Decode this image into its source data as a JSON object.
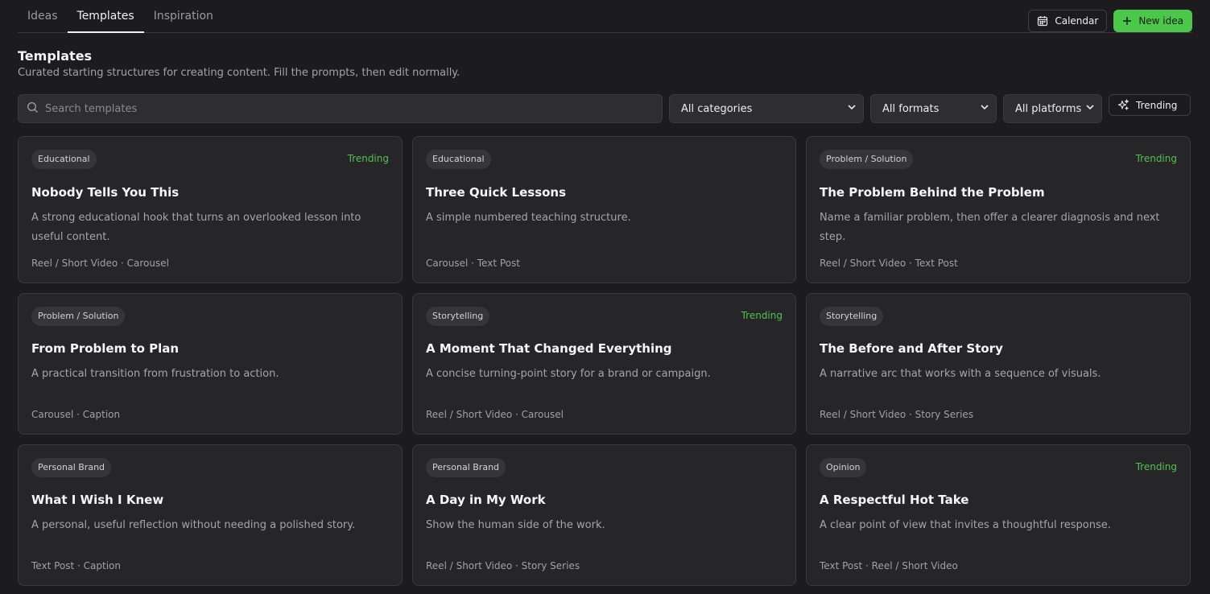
{
  "nav": {
    "tabs": [
      "Ideas",
      "Templates",
      "Inspiration"
    ],
    "active_tab": "Templates"
  },
  "actions": {
    "calendar_label": "Calendar",
    "new_idea_label": "New idea"
  },
  "header": {
    "title": "Templates",
    "subtitle": "Curated starting structures for creating content. Fill the prompts, then edit normally."
  },
  "filters": {
    "search_placeholder": "Search templates",
    "search_value": "",
    "category": "All categories",
    "format": "All formats",
    "platform": "All platforms",
    "trending_label": "Trending"
  },
  "colors": {
    "accent_green": "#4bc84a",
    "trending_text": "#4fc24e",
    "background": "#1c1c1e",
    "card": "#262628"
  },
  "cards": [
    {
      "category": "Educational",
      "trending": "Trending",
      "title": "Nobody Tells You This",
      "description": "A strong educational hook that turns an overlooked lesson into useful content.",
      "formats": "Reel / Short Video · Carousel"
    },
    {
      "category": "Educational",
      "trending": "",
      "title": "Three Quick Lessons",
      "description": "A simple numbered teaching structure.",
      "formats": "Carousel · Text Post"
    },
    {
      "category": "Problem / Solution",
      "trending": "Trending",
      "title": "The Problem Behind the Problem",
      "description": "Name a familiar problem, then offer a clearer diagnosis and next step.",
      "formats": "Reel / Short Video · Text Post"
    },
    {
      "category": "Problem / Solution",
      "trending": "",
      "title": "From Problem to Plan",
      "description": "A practical transition from frustration to action.",
      "formats": "Carousel · Caption"
    },
    {
      "category": "Storytelling",
      "trending": "Trending",
      "title": "A Moment That Changed Everything",
      "description": "A concise turning-point story for a brand or campaign.",
      "formats": "Reel / Short Video · Carousel"
    },
    {
      "category": "Storytelling",
      "trending": "",
      "title": "The Before and After Story",
      "description": "A narrative arc that works with a sequence of visuals.",
      "formats": "Reel / Short Video · Story Series"
    },
    {
      "category": "Personal Brand",
      "trending": "",
      "title": "What I Wish I Knew",
      "description": "A personal, useful reflection without needing a polished story.",
      "formats": "Text Post · Caption"
    },
    {
      "category": "Personal Brand",
      "trending": "",
      "title": "A Day in My Work",
      "description": "Show the human side of the work.",
      "formats": "Reel / Short Video · Story Series"
    },
    {
      "category": "Opinion",
      "trending": "Trending",
      "title": "A Respectful Hot Take",
      "description": "A clear point of view that invites a thoughtful response.",
      "formats": "Text Post · Reel / Short Video"
    }
  ]
}
